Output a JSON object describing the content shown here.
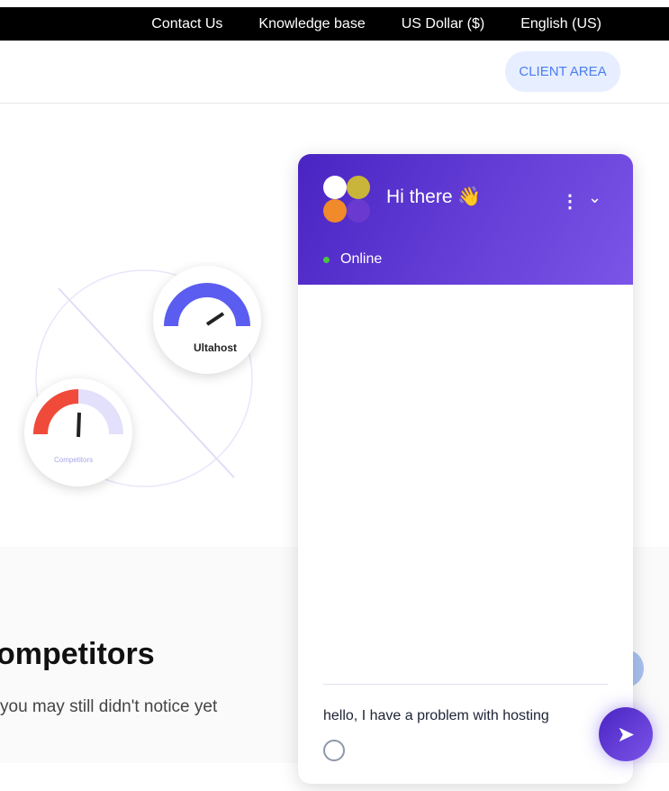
{
  "topbar": {
    "items": [
      "Contact Us",
      "Knowledge base",
      "US Dollar ($)",
      "English (US)"
    ]
  },
  "header": {
    "client_area": "CLIENT AREA"
  },
  "illustration": {
    "brand": "Ultahost",
    "competitor_label": "Competitors"
  },
  "section": {
    "heading": "ompetitors",
    "subtext": "you may still didn't notice yet"
  },
  "chat": {
    "title": "Hi there 👋",
    "status": "Online",
    "status_color": "#4bc43f",
    "message": "hello, I have a problem with hosting",
    "accent": "#5a34d4"
  }
}
